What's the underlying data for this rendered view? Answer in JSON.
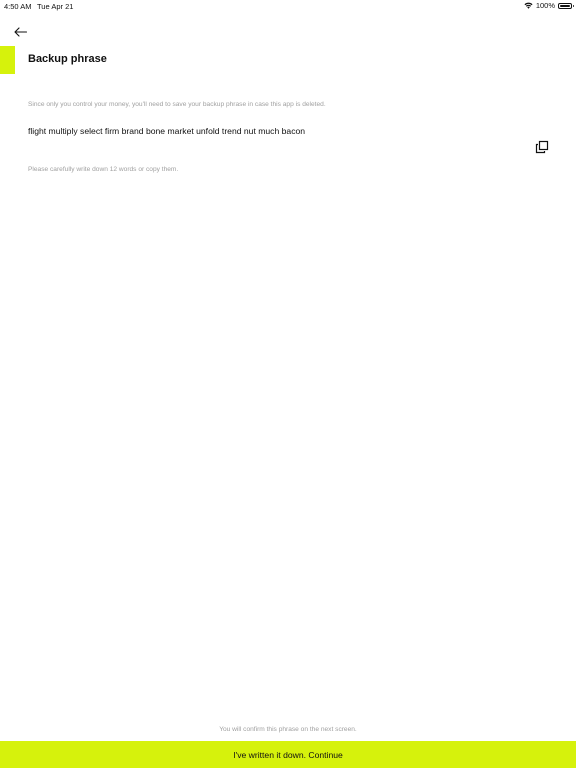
{
  "status_bar": {
    "time": "4:50 AM",
    "date": "Tue Apr 21",
    "battery": "100%"
  },
  "header": {
    "title": "Backup phrase"
  },
  "content": {
    "description": "Since only you control your money, you'll need to save your backup phrase in case this app is deleted.",
    "phrase": "flight multiply select firm brand bone market unfold trend nut much bacon",
    "hint": "Please carefully write down 12 words or copy them."
  },
  "footer": {
    "note": "You will confirm this phrase on the next screen.",
    "continue_label": "I've written it down. Continue"
  },
  "icons": {
    "back": "arrow-left-icon",
    "copy": "copy-icon",
    "wifi": "wifi-icon",
    "battery": "battery-icon"
  },
  "colors": {
    "accent": "#d6f20c",
    "muted_text": "#a0a0a0",
    "text": "#111111"
  }
}
